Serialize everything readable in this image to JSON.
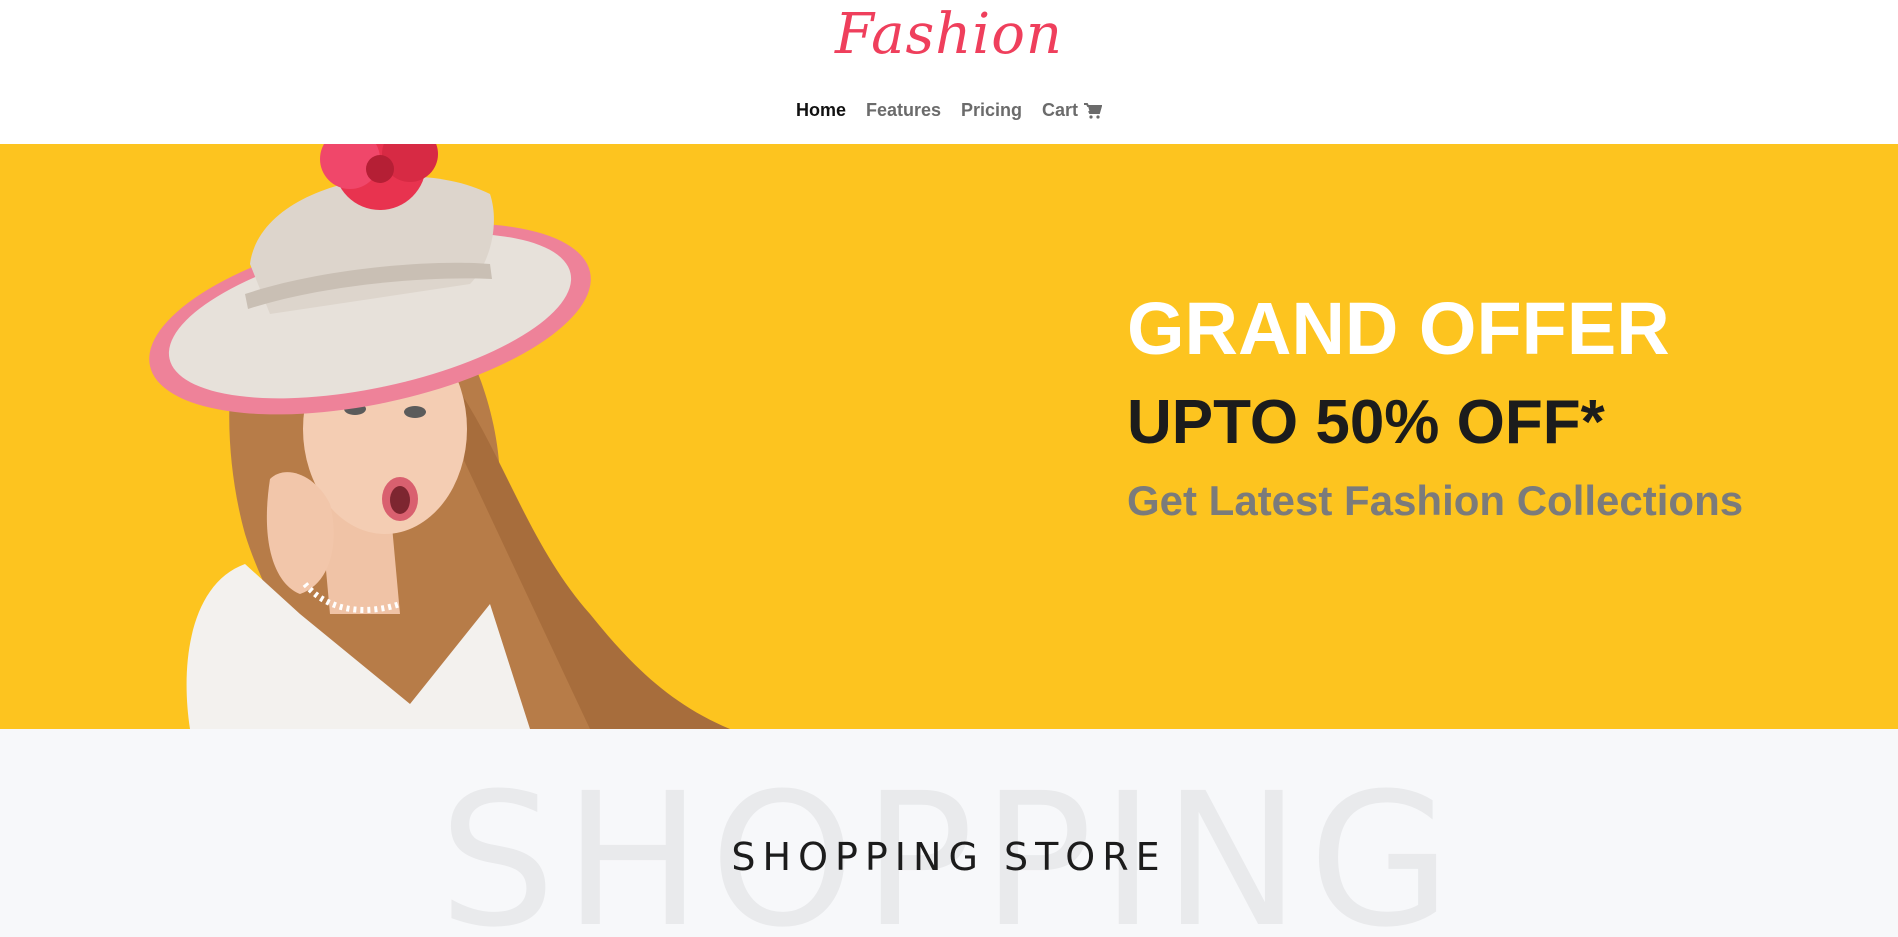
{
  "header": {
    "logo": "Fashion",
    "nav": {
      "home": "Home",
      "features": "Features",
      "pricing": "Pricing",
      "cart": "Cart"
    }
  },
  "hero": {
    "title": "GRAND OFFER",
    "offer": "UPTO 50% OFF*",
    "subtitle": "Get Latest Fashion Collections"
  },
  "section": {
    "background_word": "SHOPPING",
    "title": "SHOPPING STORE"
  },
  "colors": {
    "brand": "#ef3f5c",
    "hero_bg": "#fdc41f",
    "section_bg": "#f7f8fa"
  },
  "icons": {
    "cart": "cart-icon"
  }
}
